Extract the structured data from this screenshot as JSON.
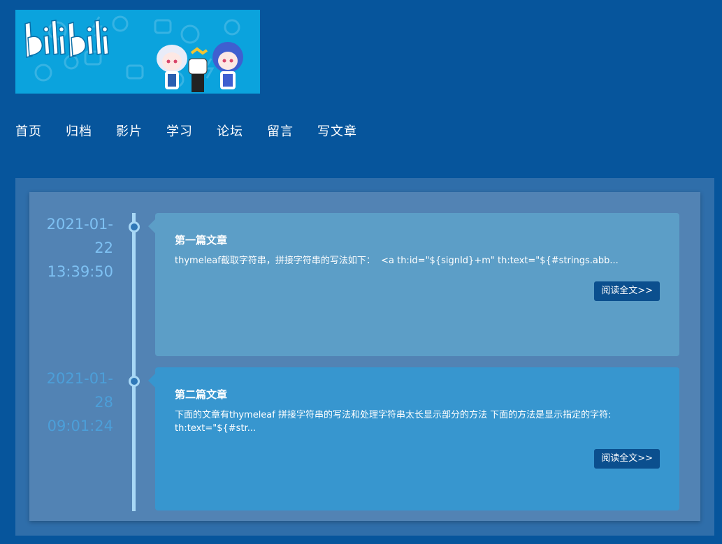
{
  "banner": {
    "logo_text": "bilibili"
  },
  "nav": {
    "items": [
      "首页",
      "归档",
      "影片",
      "学习",
      "论坛",
      "留言",
      "写文章"
    ]
  },
  "posts": [
    {
      "date_line1": "2021-01-",
      "date_line2": "22",
      "date_line3": "13:39:50",
      "title": "第一篇文章",
      "excerpt": "thymeleaf截取字符串，拼接字符串的写法如下：  <a th:id=\"${signId}+m\" th:text=\"${#strings.abb...",
      "read_more": "阅读全文>>"
    },
    {
      "date_line1": "2021-01-",
      "date_line2": "28",
      "date_line3": "09:01:24",
      "title": "第二篇文章",
      "excerpt": "下面的文章有thymeleaf 拼接字符串的写法和处理字符串太长显示部分的方法 下面的方法是显示指定的字符:\nth:text=\"${#str...",
      "read_more": "阅读全文>>"
    }
  ],
  "colors": {
    "page_bg": "#06559c",
    "frame_bg": "#2f6eaa",
    "panel_bg": "#5283b4",
    "card1_bg": "#5c9ec7",
    "card2_bg": "#3796cf",
    "button_bg": "#0b4f8e",
    "timeline": "#a8d8f6"
  }
}
